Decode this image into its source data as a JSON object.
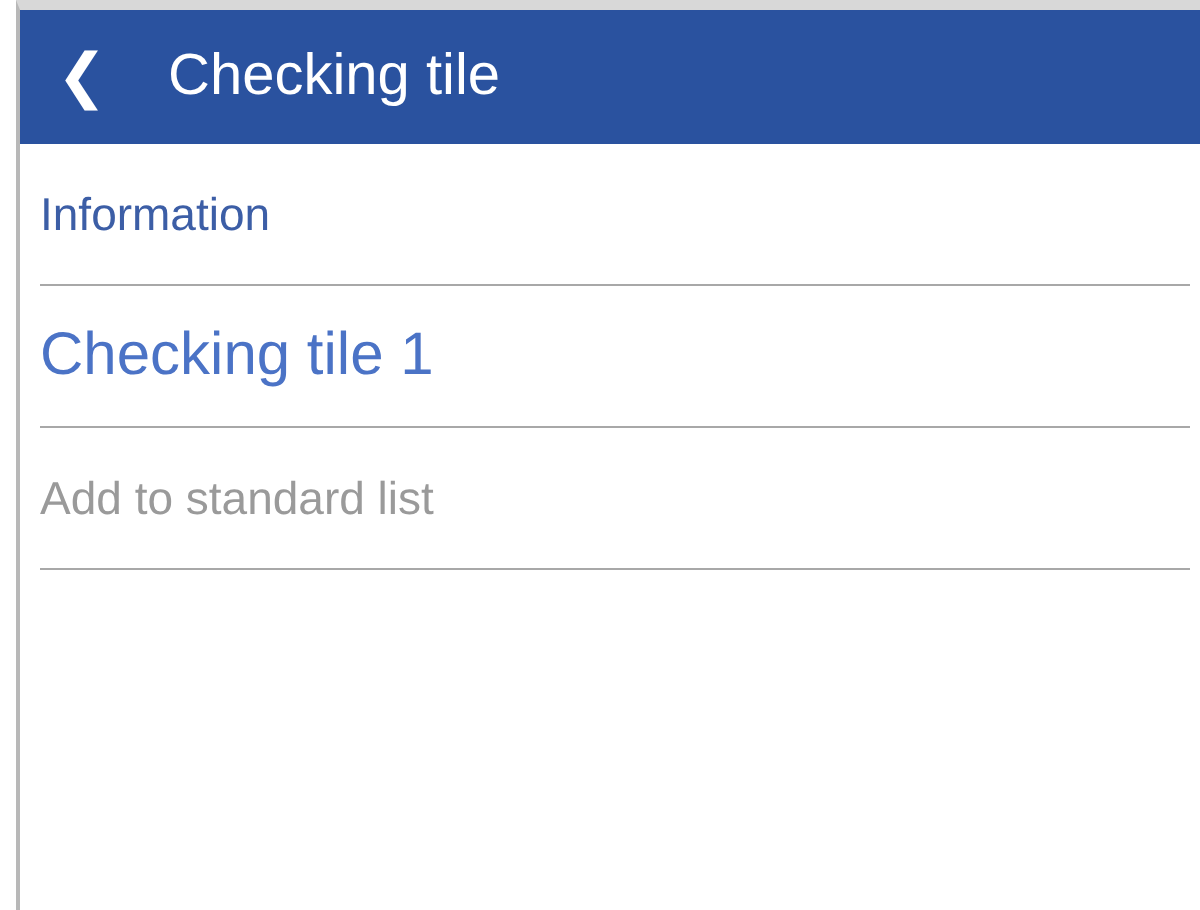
{
  "header": {
    "back": "❮",
    "title": "Checking tile"
  },
  "rows": [
    {
      "kind": "section",
      "text": "Information"
    },
    {
      "kind": "item",
      "text": "Checking tile 1"
    },
    {
      "kind": "action",
      "text": "Add to standard list",
      "disabled": true
    }
  ]
}
